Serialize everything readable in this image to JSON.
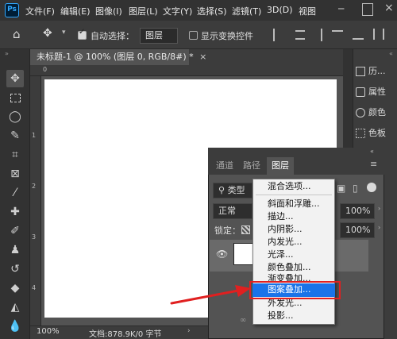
{
  "app": {
    "logo_text": "Ps"
  },
  "menu": [
    "文件(F)",
    "编辑(E)",
    "图像(I)",
    "图层(L)",
    "文字(Y)",
    "选择(S)",
    "滤镜(T)",
    "3D(D)",
    "视图"
  ],
  "options_bar": {
    "auto_select_label": "自动选择：",
    "auto_select_value": "图层",
    "show_transform_label": "显示变换控件"
  },
  "document": {
    "tab_title": "未标题-1 @ 100% (图层 0, RGB/8#) *",
    "close_glyph": "×"
  },
  "rulers": {
    "top_ticks": [
      "0"
    ],
    "left_ticks": [
      "1",
      "2",
      "3",
      "4"
    ]
  },
  "status": {
    "zoom": "100%",
    "doc_info": "文档:878.9K/0 字节"
  },
  "right_panels": [
    {
      "label": "历...",
      "icon": "history-icon"
    },
    {
      "label": "属性",
      "icon": "properties-icon"
    },
    {
      "label": "颜色",
      "icon": "color-icon"
    },
    {
      "label": "色板",
      "icon": "swatches-icon"
    }
  ],
  "layers_panel": {
    "tabs": [
      "通道",
      "路径",
      "图层"
    ],
    "active_tab": "图层",
    "filter_kind": "类型",
    "blend_mode": "正常",
    "opacity_value": "100%",
    "lock_label": "锁定：",
    "fill_value": "100%"
  },
  "context_menu": {
    "items": [
      "混合选项...",
      "斜面和浮雕...",
      "描边...",
      "内阴影...",
      "内发光...",
      "光泽...",
      "颜色叠加...",
      "渐变叠加...",
      "图案叠加...",
      "外发光...",
      "投影..."
    ],
    "highlighted": "图案叠加..."
  },
  "colors": {
    "highlight": "#1a73e8",
    "annotation": "#e02020",
    "ps_blue": "#31a8ff"
  }
}
